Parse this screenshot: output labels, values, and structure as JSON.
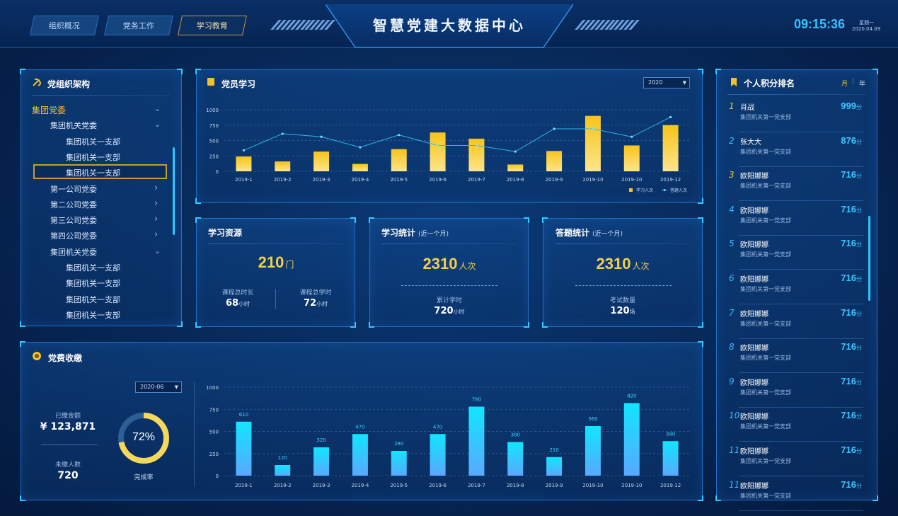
{
  "header": {
    "tabs": [
      {
        "label": "组织概况",
        "active": false
      },
      {
        "label": "党务工作",
        "active": false
      },
      {
        "label": "学习教育",
        "active": true
      }
    ],
    "title": "智慧党建大数据中心",
    "time": "09:15:36",
    "weekday": "星期一",
    "date": "2020.04.09"
  },
  "org": {
    "title": "党组织架构",
    "items": [
      {
        "label": "集团党委",
        "level": 0,
        "chevron": "down"
      },
      {
        "label": "集团机关党委",
        "level": 1,
        "chevron": "down"
      },
      {
        "label": "集团机关一支部",
        "level": 2,
        "chevron": ""
      },
      {
        "label": "集团机关一支部",
        "level": 2,
        "chevron": ""
      },
      {
        "label": "集团机关一支部",
        "level": 2,
        "chevron": "",
        "selected": true
      },
      {
        "label": "第一公司党委",
        "level": 1,
        "chevron": "right"
      },
      {
        "label": "第二公司党委",
        "level": 1,
        "chevron": "right"
      },
      {
        "label": "第三公司党委",
        "level": 1,
        "chevron": "right"
      },
      {
        "label": "第四公司党委",
        "level": 1,
        "chevron": "right"
      },
      {
        "label": "集团机关党委",
        "level": 1,
        "chevron": "down"
      },
      {
        "label": "集团机关一支部",
        "level": 2,
        "chevron": ""
      },
      {
        "label": "集团机关一支部",
        "level": 2,
        "chevron": ""
      },
      {
        "label": "集团机关一支部",
        "level": 2,
        "chevron": ""
      },
      {
        "label": "集团机关一支部",
        "level": 2,
        "chevron": ""
      }
    ]
  },
  "study": {
    "title": "党员学习",
    "year_select": "2020",
    "legend": [
      "学习人次",
      "答题人次"
    ]
  },
  "resources": {
    "title": "学习资源",
    "count": "210",
    "count_unit": "门",
    "left_label": "课程总时长",
    "left_value": "68",
    "left_unit": "小时",
    "right_label": "课程总学时",
    "right_value": "72",
    "right_unit": "小时"
  },
  "study_stats": {
    "title": "学习统计",
    "sub": "(近一个月)",
    "count": "2310",
    "count_unit": "人次",
    "label": "累计学时",
    "value": "720",
    "unit": "小时"
  },
  "quiz_stats": {
    "title": "答题统计",
    "sub": "(近一个月)",
    "count": "2310",
    "count_unit": "人次",
    "label": "考试数量",
    "value": "120",
    "unit": "场"
  },
  "fees": {
    "title": "党费收缴",
    "month_select": "2020-06",
    "paid_label": "已缴金额",
    "paid_value": "¥ 123,871",
    "unpaid_label": "未缴人数",
    "unpaid_value": "720",
    "rate": "72%",
    "rate_value": 0.72,
    "rate_label": "完成率"
  },
  "ranking": {
    "title": "个人积分排名",
    "toggle_month": "月",
    "toggle_year": "年",
    "score_unit": "分",
    "rows": [
      {
        "rank": "1",
        "name": "肖战",
        "dept": "集团机关第一党支部",
        "score": "999"
      },
      {
        "rank": "2",
        "name": "张大大",
        "dept": "集团机关第一党支部",
        "score": "876"
      },
      {
        "rank": "3",
        "name": "欧阳娜娜",
        "dept": "集团机关第一党支部",
        "score": "716"
      },
      {
        "rank": "4",
        "name": "欧阳娜娜",
        "dept": "集团机关第一党支部",
        "score": "716"
      },
      {
        "rank": "5",
        "name": "欧阳娜娜",
        "dept": "集团机关第一党支部",
        "score": "716"
      },
      {
        "rank": "6",
        "name": "欧阳娜娜",
        "dept": "集团机关第一党支部",
        "score": "716"
      },
      {
        "rank": "7",
        "name": "欧阳娜娜",
        "dept": "集团机关第一党支部",
        "score": "716"
      },
      {
        "rank": "8",
        "name": "欧阳娜娜",
        "dept": "集团机关第一党支部",
        "score": "716"
      },
      {
        "rank": "9",
        "name": "欧阳娜娜",
        "dept": "集团机关第一党支部",
        "score": "716"
      },
      {
        "rank": "10",
        "name": "欧阳娜娜",
        "dept": "集团机关第一党支部",
        "score": "716"
      },
      {
        "rank": "11",
        "name": "欧阳娜娜",
        "dept": "集团机关第一党支部",
        "score": "716"
      },
      {
        "rank": "11",
        "name": "欧阳娜娜",
        "dept": "集团机关第一党支部",
        "score": "716"
      }
    ]
  },
  "chart_data": [
    {
      "type": "bar",
      "categories": [
        "2019-1",
        "2019-2",
        "2019-3",
        "2019-4",
        "2019-5",
        "2019-6",
        "2019-7",
        "2019-8",
        "2019-9",
        "2019-10",
        "2019-10",
        "2019-12"
      ],
      "series": [
        {
          "name": "学习人次",
          "type": "bar",
          "values": [
            240,
            160,
            320,
            120,
            360,
            630,
            530,
            110,
            330,
            900,
            420,
            750
          ]
        },
        {
          "name": "答题人次",
          "type": "line",
          "values": [
            340,
            610,
            560,
            390,
            590,
            420,
            420,
            320,
            690,
            690,
            560,
            880
          ]
        }
      ],
      "yticks": [
        0,
        250,
        500,
        750,
        1000
      ],
      "ylim": [
        0,
        1000
      ],
      "grid": true,
      "legend": "bottom-right"
    },
    {
      "type": "bar",
      "categories": [
        "2019-1",
        "2019-2",
        "2019-3",
        "2019-4",
        "2019-5",
        "2019-6",
        "2019-7",
        "2019-8",
        "2019-9",
        "2019-10",
        "2019-10",
        "2019-12"
      ],
      "values": [
        610,
        120,
        320,
        470,
        280,
        470,
        780,
        380,
        210,
        560,
        820,
        390
      ],
      "data_labels": [
        "610",
        "120",
        "320",
        "470",
        "280",
        "470",
        "780",
        "380",
        "210",
        "560",
        "820",
        "390"
      ],
      "yticks": [
        0,
        250,
        500,
        750,
        1000
      ],
      "ylim": [
        0,
        1000
      ],
      "grid": true
    }
  ],
  "colors": {
    "accent_gold": "#f5c02c",
    "accent_cyan": "#37c2ff",
    "bar_gold": "#f3c41d",
    "bar_cyan": "#13e0ff"
  }
}
